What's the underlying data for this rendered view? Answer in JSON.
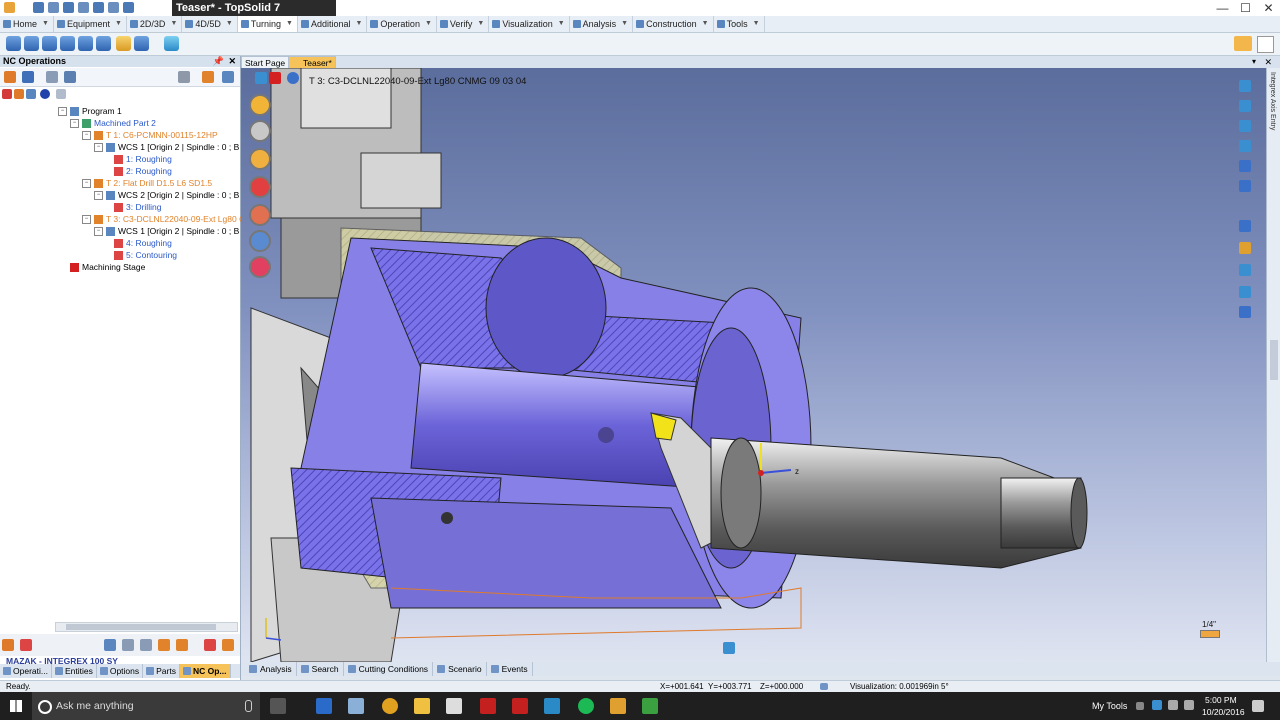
{
  "window": {
    "doc_title": "Teaser* - TopSolid 7",
    "min": "—",
    "max": "☐",
    "close": "✕"
  },
  "menu": [
    {
      "label": "Home",
      "icon": "home-icon"
    },
    {
      "label": "Equipment",
      "icon": "equipment-icon"
    },
    {
      "label": "2D/3D",
      "icon": "2d3d-icon"
    },
    {
      "label": "4D/5D",
      "icon": "4d5d-icon"
    },
    {
      "label": "Turning",
      "icon": "turning-icon"
    },
    {
      "label": "Additional",
      "icon": "additional-icon"
    },
    {
      "label": "Operation",
      "icon": "operation-icon"
    },
    {
      "label": "Verify",
      "icon": "verify-icon"
    },
    {
      "label": "Visualization",
      "icon": "visualization-icon"
    },
    {
      "label": "Analysis",
      "icon": "analysis-icon"
    },
    {
      "label": "Construction",
      "icon": "construction-icon"
    },
    {
      "label": "Tools",
      "icon": "tools-icon"
    }
  ],
  "left_panel": {
    "title": "NC Operations",
    "pin": "📌",
    "close": "✕",
    "tree": [
      {
        "label": "Program 1",
        "indent": 0,
        "color": "black"
      },
      {
        "label": "Machined Part 2",
        "indent": 1,
        "color": "blue"
      },
      {
        "label": "T 1: C6-PCMNN-00115-12HP",
        "indent": 2,
        "color": "orange"
      },
      {
        "label": "WCS 1 [Origin 2 | Spindle : 0 ; B : 4",
        "indent": 3,
        "color": "black"
      },
      {
        "label": "1: Roughing",
        "indent": 4,
        "color": "blue"
      },
      {
        "label": "2: Roughing",
        "indent": 4,
        "color": "blue"
      },
      {
        "label": "T 2: Flat Drill D1.5 L6 SD1.5",
        "indent": 2,
        "color": "orange"
      },
      {
        "label": "WCS 2 [Origin 2 | Spindle : 0 ; B : 0",
        "indent": 3,
        "color": "black"
      },
      {
        "label": "3: Drilling",
        "indent": 4,
        "color": "blue"
      },
      {
        "label": "T 3: C3-DCLNL22040-09-Ext Lg80 CI",
        "indent": 2,
        "color": "orange"
      },
      {
        "label": "WCS 1 [Origin 2 | Spindle : 0 ; B : 0",
        "indent": 3,
        "color": "black"
      },
      {
        "label": "4: Roughing",
        "indent": 4,
        "color": "blue"
      },
      {
        "label": "5: Contouring",
        "indent": 4,
        "color": "blue"
      },
      {
        "label": "Machining Stage",
        "indent": 1,
        "color": "black"
      }
    ],
    "machine_label": "MAZAK - INTEGREX 100 SY",
    "tabs": [
      {
        "label": "Operati...",
        "active": false
      },
      {
        "label": "Entities",
        "active": false
      },
      {
        "label": "Options",
        "active": false
      },
      {
        "label": "Parts",
        "active": false
      },
      {
        "label": "NC Op...",
        "active": true
      }
    ]
  },
  "doc_tabs": [
    {
      "label": "Start Page",
      "active": false
    },
    {
      "label": "Teaser*",
      "active": true
    }
  ],
  "doc_tab_pin": "▾",
  "doc_tab_close": "✕",
  "viewport": {
    "tool_label": "T 3: C3-DCLNL22040-09-Ext Lg80 CNMG 09 03 04",
    "scale_label": "1/4\"",
    "axis_z": "z",
    "right_strip_label": "Integrex Axis Entry"
  },
  "bottom_tabs": [
    {
      "label": "Analysis"
    },
    {
      "label": "Search"
    },
    {
      "label": "Cutting Conditions"
    },
    {
      "label": "Scenario"
    },
    {
      "label": "Events"
    }
  ],
  "status": {
    "text": "Ready.",
    "x": "X=+001.641",
    "y": "Y=+003.771",
    "z": "Z=+000.000",
    "visualization": "Visualization: 0.001969in 5°"
  },
  "taskbar": {
    "search_placeholder": "Ask me anything",
    "my_tools": "My Tools",
    "time": "5:00 PM",
    "date": "10/20/2016"
  }
}
